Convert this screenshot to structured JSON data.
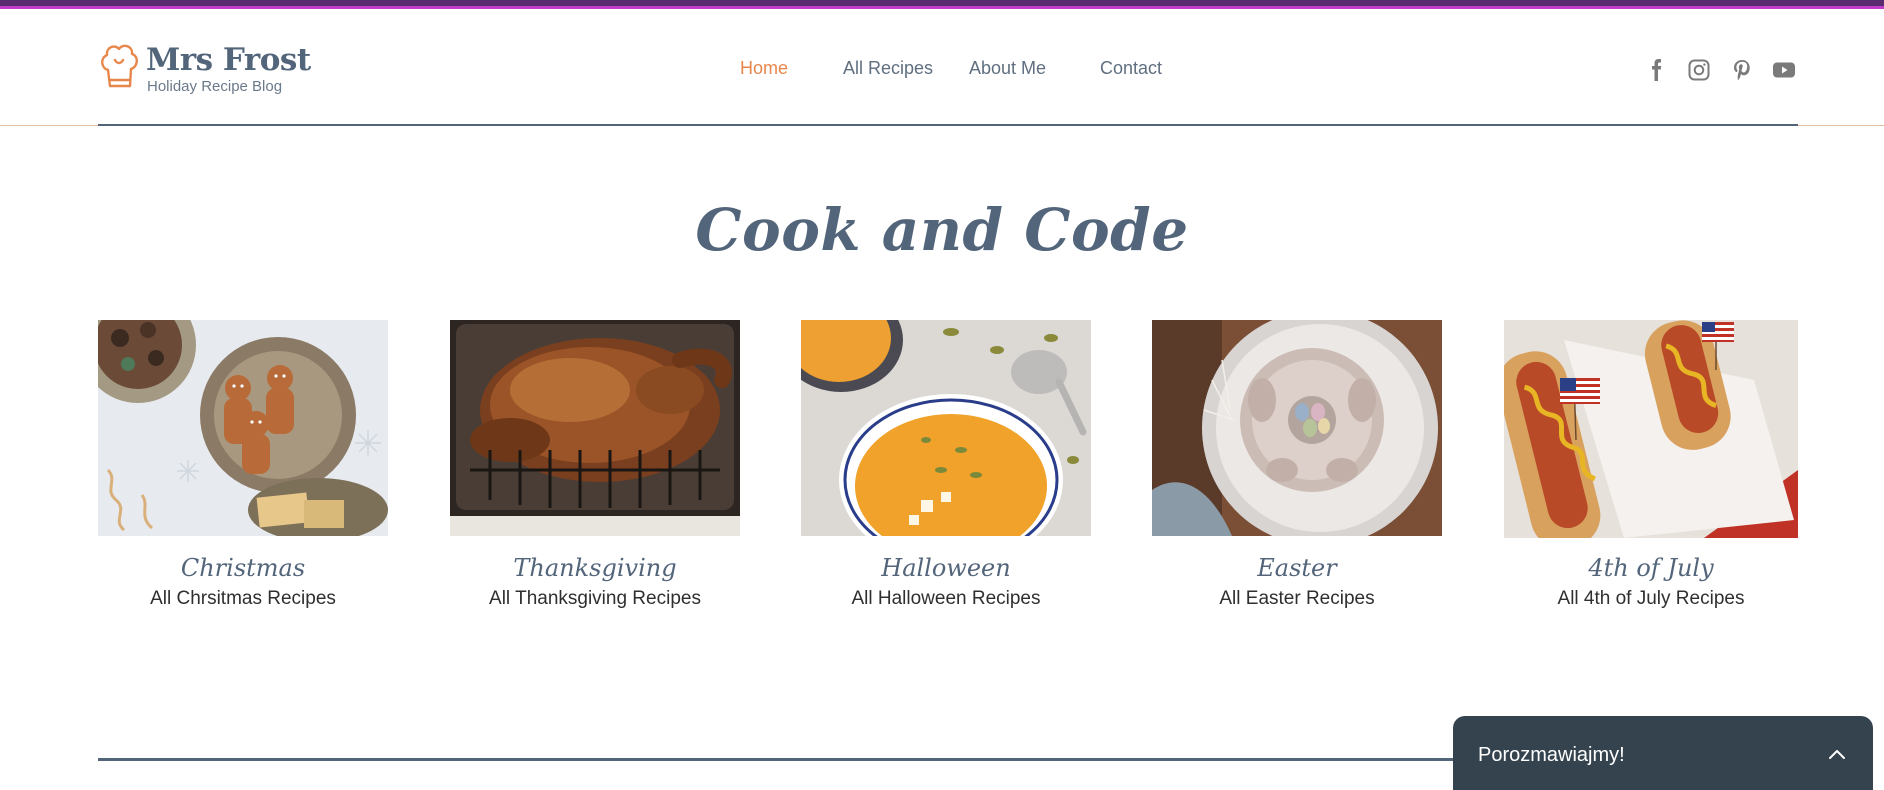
{
  "brand": {
    "name": "Mrs Frost",
    "tagline": "Holiday Recipe Blog",
    "icon": "chef-hat-icon",
    "color": "#53657a",
    "accent": "#e8874c"
  },
  "nav": {
    "items": [
      {
        "label": "Home",
        "active": true
      },
      {
        "label": "All Recipes",
        "active": false
      },
      {
        "label": "About Me",
        "active": false
      },
      {
        "label": "Contact",
        "active": false
      }
    ]
  },
  "social": [
    "facebook-icon",
    "instagram-icon",
    "pinterest-icon",
    "youtube-icon"
  ],
  "main": {
    "title": "Cook and Code",
    "categories": [
      {
        "title": "Christmas",
        "link": "All Chrsitmas Recipes",
        "image": "gingerbread-cookies-image"
      },
      {
        "title": "Thanksgiving",
        "link": "All Thanksgiving Recipes",
        "image": "roast-turkey-image"
      },
      {
        "title": "Halloween",
        "link": "All Halloween Recipes",
        "image": "pumpkin-soup-image"
      },
      {
        "title": "Easter",
        "link": "All Easter Recipes",
        "image": "bundt-cake-eggs-image"
      },
      {
        "title": "4th of July",
        "link": "All 4th of July Recipes",
        "image": "hot-dogs-flags-image"
      }
    ]
  },
  "chat": {
    "label": "Porozmawiajmy!",
    "icon": "chevron-up-icon"
  }
}
